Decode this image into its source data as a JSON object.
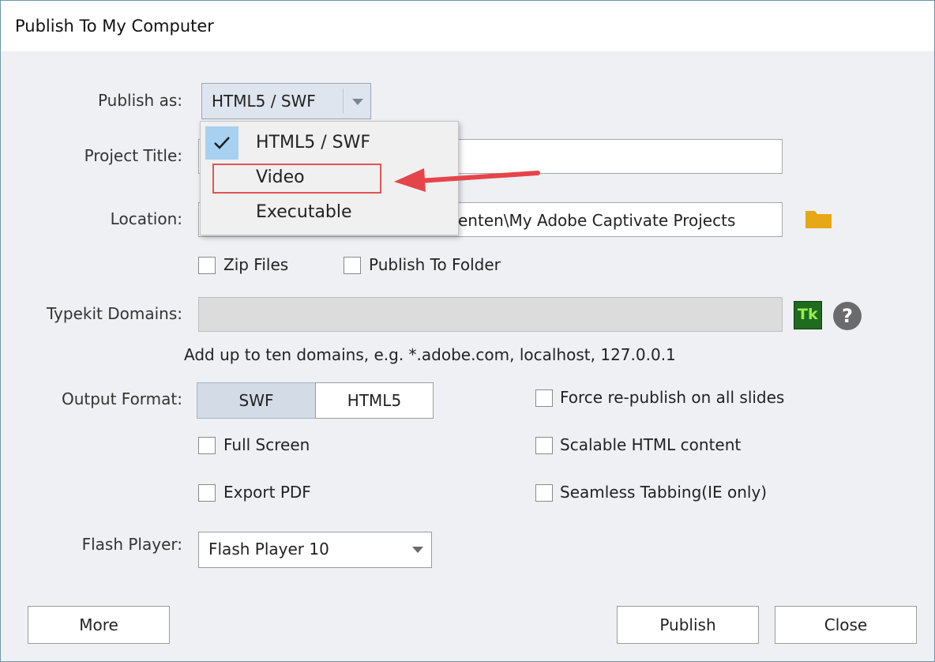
{
  "window": {
    "title": "Publish To My Computer"
  },
  "publish_as": {
    "label": "Publish as:",
    "selected": "HTML5 / SWF",
    "options": [
      "HTML5 / SWF",
      "Video",
      "Executable"
    ]
  },
  "project_title": {
    "label": "Project Title:"
  },
  "location": {
    "label": "Location:",
    "value": "enten\\My Adobe Captivate Projects"
  },
  "checkboxes": {
    "zip_files": "Zip Files",
    "publish_to_folder": "Publish To Folder",
    "force_republish": "Force re-publish on all slides",
    "full_screen": "Full Screen",
    "scalable_html": "Scalable HTML content",
    "export_pdf": "Export PDF",
    "seamless_tabbing": "Seamless Tabbing(IE only)"
  },
  "typekit": {
    "label": "Typekit Domains:",
    "hint": "Add up to ten domains, e.g. *.adobe.com, localhost, 127.0.0.1",
    "tk_badge": "Tk",
    "help": "?"
  },
  "output_format": {
    "label": "Output Format:",
    "options": [
      "SWF",
      "HTML5"
    ],
    "selected": "SWF"
  },
  "flash_player": {
    "label": "Flash Player:",
    "selected": "Flash Player 10"
  },
  "buttons": {
    "more": "More",
    "publish": "Publish",
    "close": "Close"
  },
  "colors": {
    "menu_selected_tick_bg": "#a8d0f0",
    "highlight_box": "#e05555",
    "arrow": "#e5454a",
    "folder": "#e6a817",
    "tk_bg": "#1f6b1f",
    "tk_text": "#9bef4a",
    "help_bg": "#6b6b6b",
    "segment_selected": "#d3dbe6"
  },
  "icons": {
    "folder": "folder-icon",
    "typekit": "typekit-icon",
    "help": "help-icon",
    "check": "check-icon",
    "dropdown": "chevron-down-icon",
    "annotation_arrow": "arrow-icon"
  }
}
